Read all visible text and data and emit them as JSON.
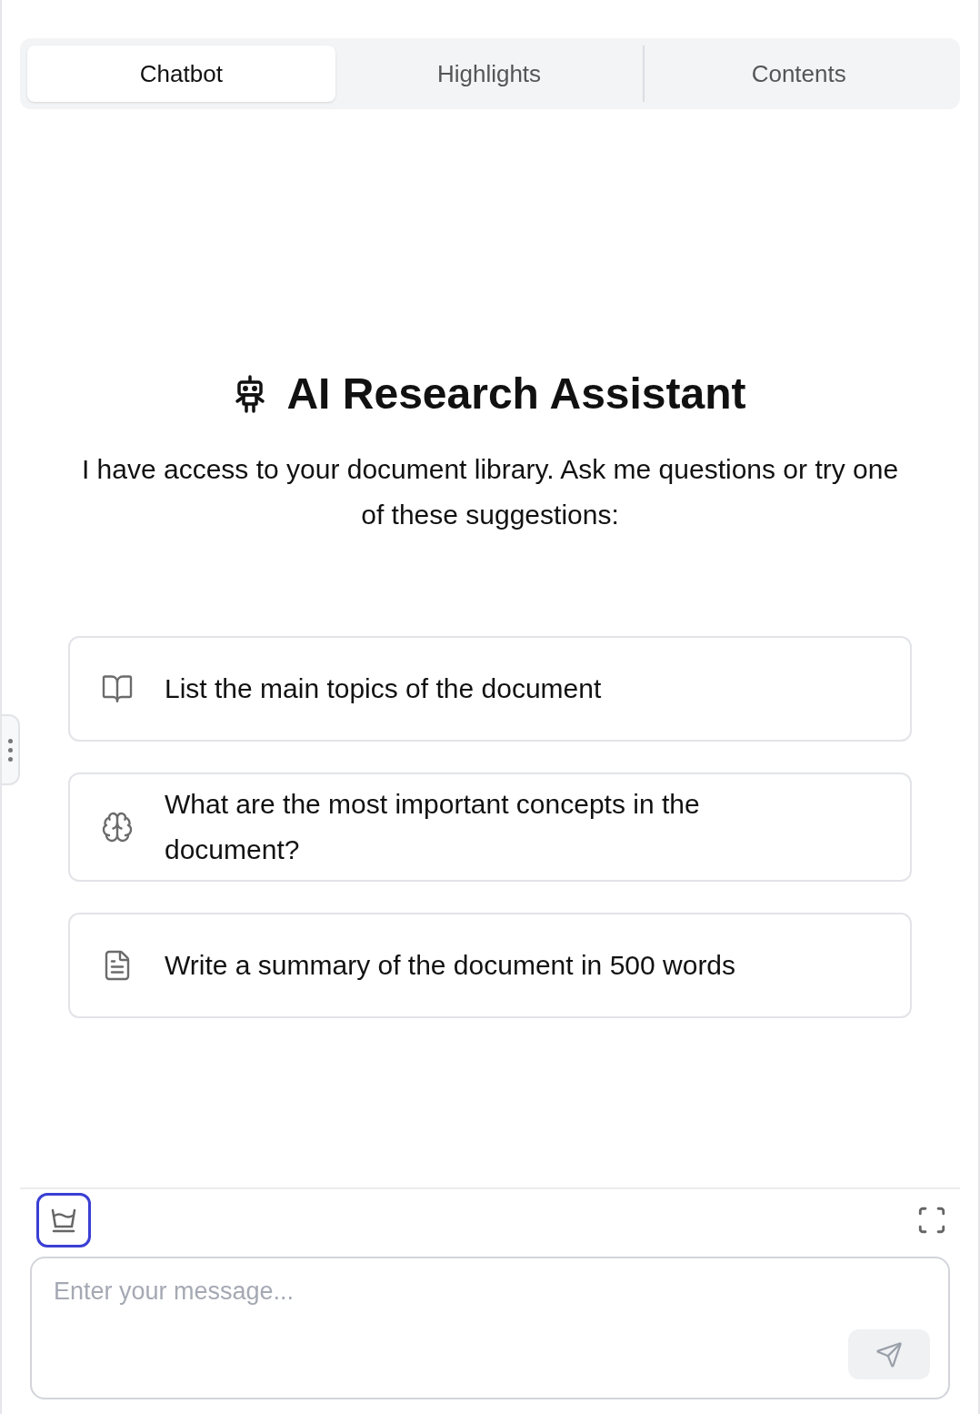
{
  "tabs": [
    {
      "label": "Chatbot",
      "selected": true
    },
    {
      "label": "Highlights",
      "selected": false
    },
    {
      "label": "Contents",
      "selected": false
    }
  ],
  "title": "AI Research Assistant",
  "subtitle": "I have access to your document library. Ask me questions or try one of these suggestions:",
  "suggestions": [
    {
      "kind": "book",
      "text": "List the main topics of the document"
    },
    {
      "kind": "brain",
      "text": "What are the most important concepts in the document?"
    },
    {
      "kind": "file",
      "text": "Write a summary of the document in 500 words"
    }
  ],
  "composer": {
    "placeholder": "Enter your message...",
    "tool_active": true
  }
}
